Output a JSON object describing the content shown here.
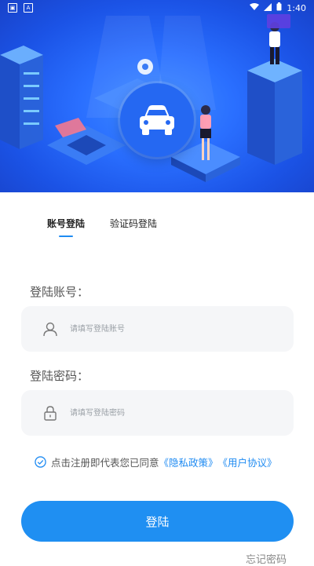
{
  "status_bar": {
    "time": "1:40",
    "left_icons": [
      "gallery-notification-icon",
      "a-notification-icon"
    ]
  },
  "hero": {
    "icon": "car-icon"
  },
  "tabs": [
    {
      "label": "账号登陆",
      "active": true
    },
    {
      "label": "验证码登陆",
      "active": false
    }
  ],
  "account": {
    "label": "登陆账号：",
    "placeholder": "请填写登陆账号",
    "icon": "user-icon"
  },
  "password": {
    "label": "登陆密码：",
    "placeholder": "请填写登陆密码",
    "icon": "lock-icon"
  },
  "agreement": {
    "prefix": "点击注册即代表您已同意",
    "privacy": "《隐私政策》",
    "user": "《用户协议》",
    "checked": true
  },
  "login_button": "登陆",
  "forgot_password": "忘记密码",
  "colors": {
    "accent": "#1f8ff2",
    "hero": "#2568f2"
  }
}
